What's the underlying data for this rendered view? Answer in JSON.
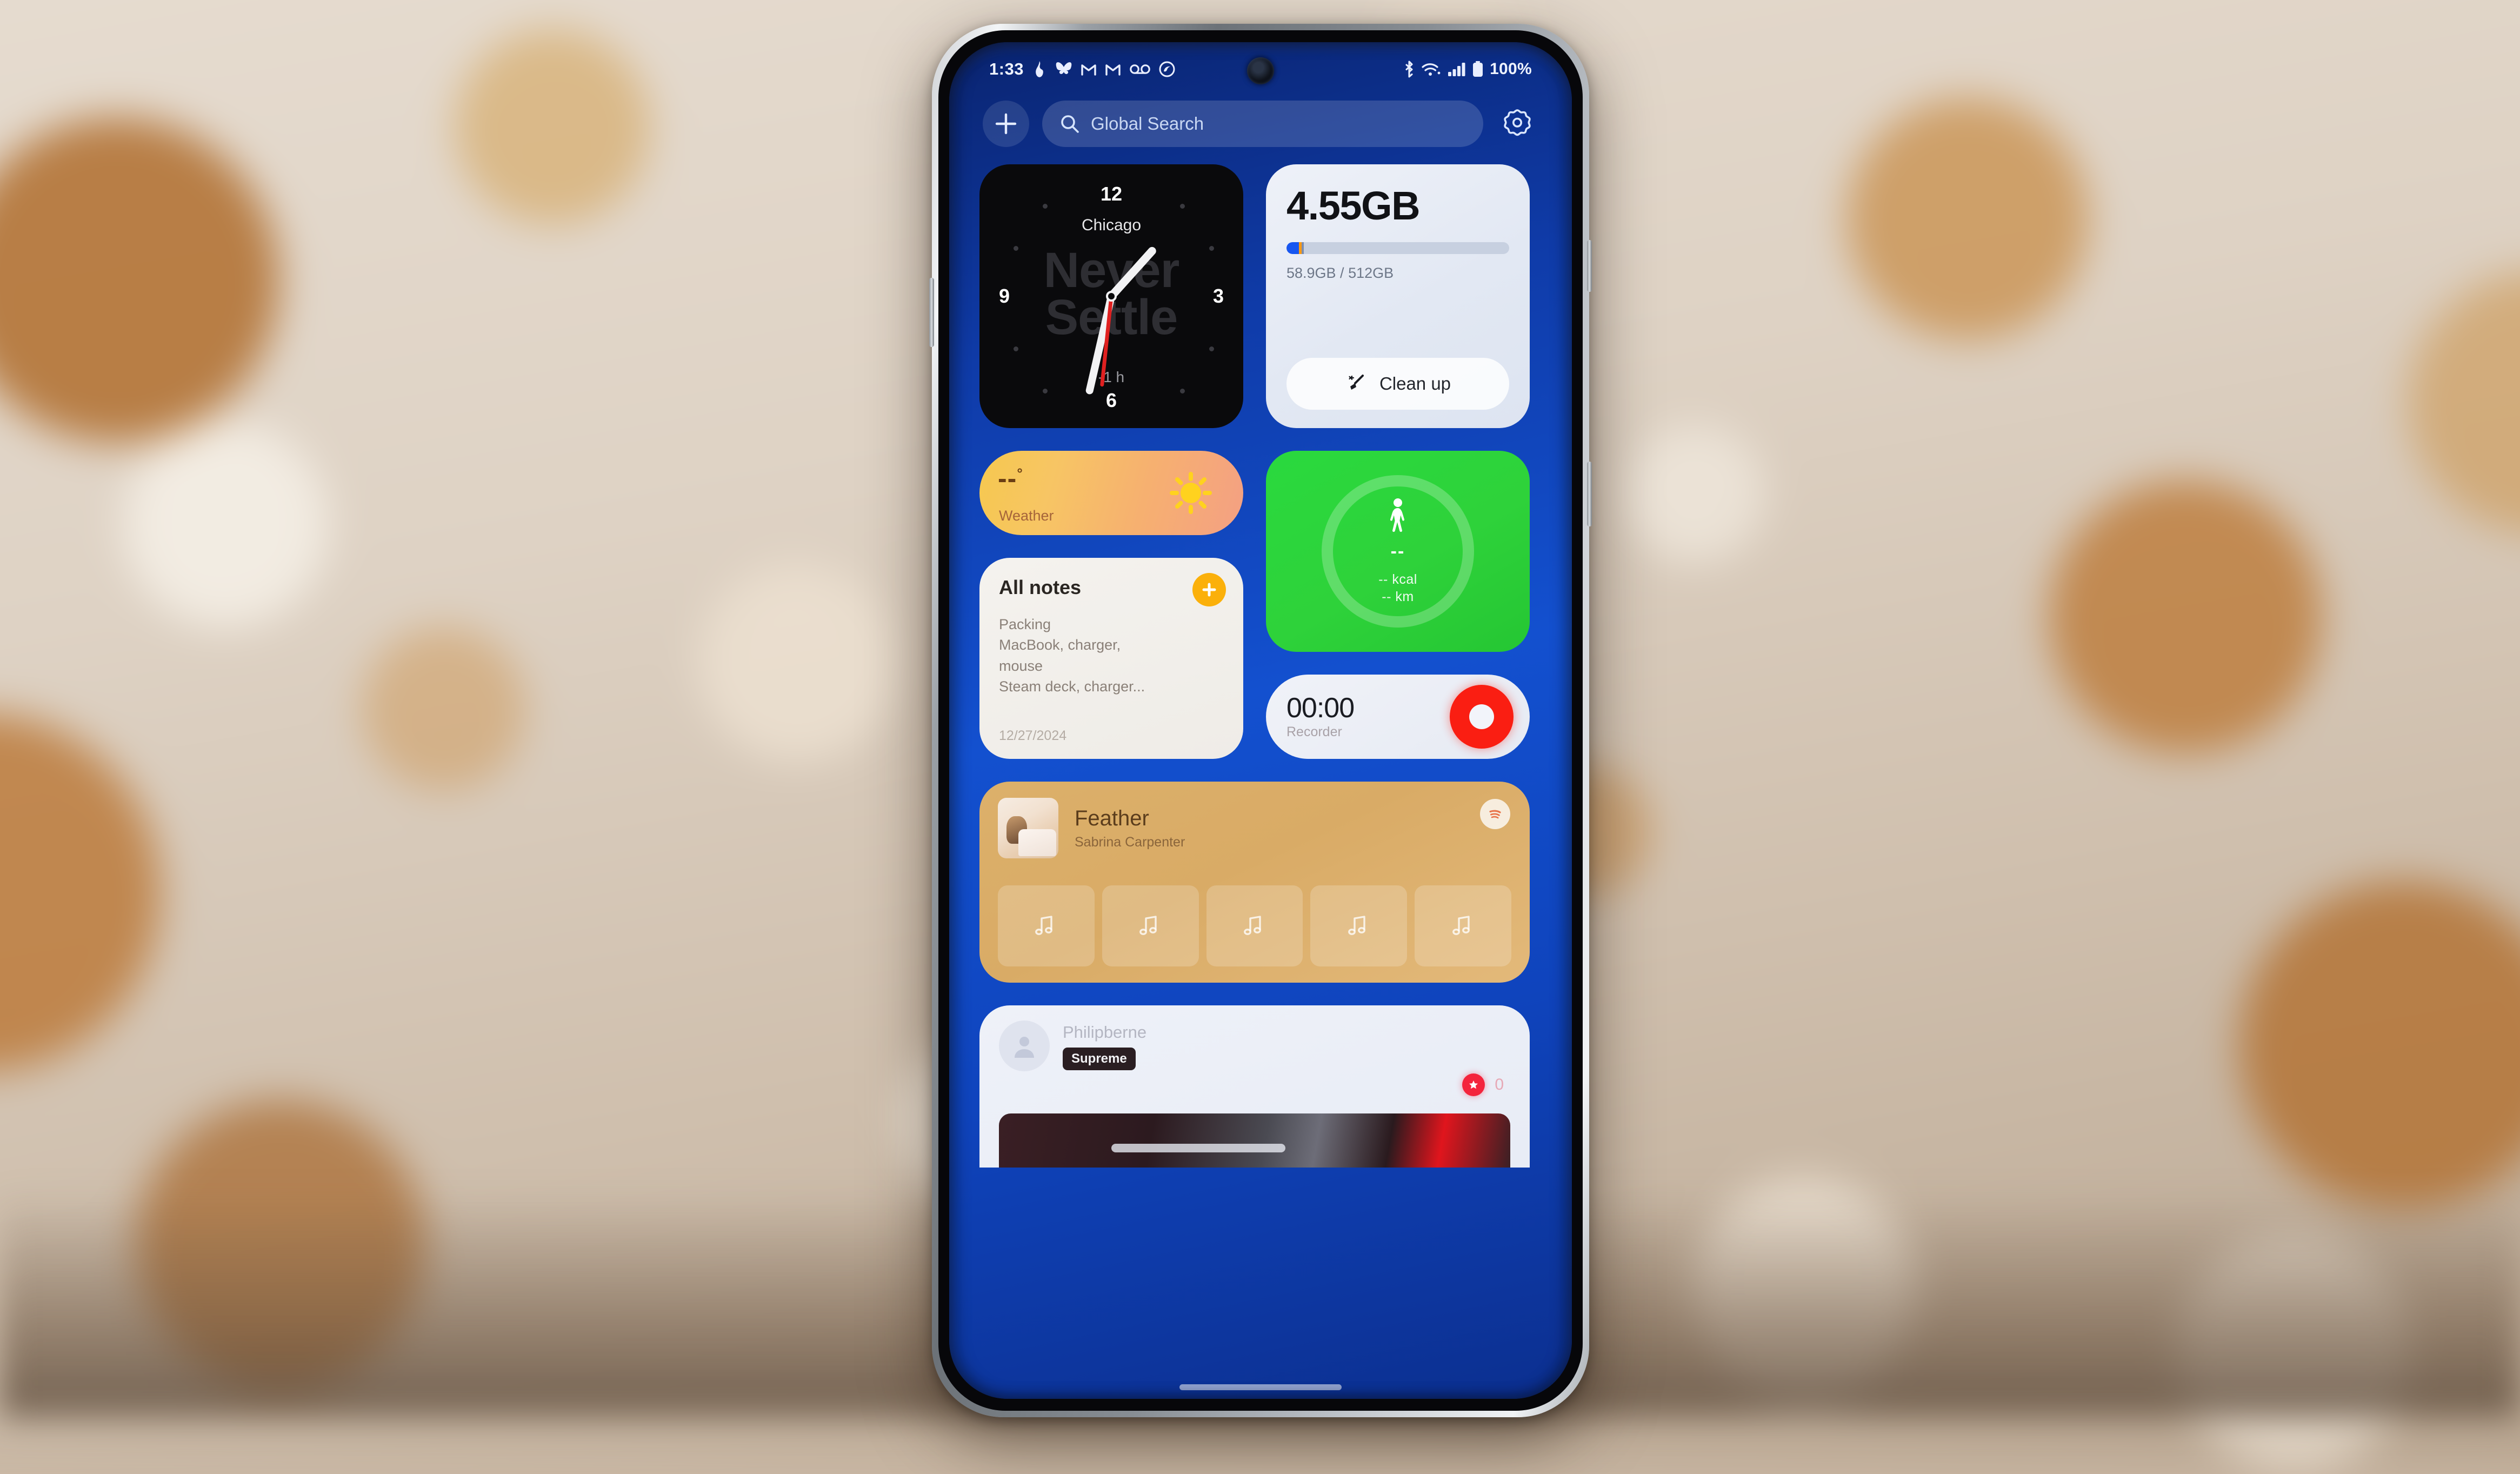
{
  "statusbar": {
    "time": "1:33",
    "battery_percent": "100%",
    "left_icons": [
      "flame-icon",
      "butterfly-icon",
      "gmail-icon",
      "gmail-icon-2",
      "voicemail-icon",
      "sync-icon"
    ],
    "right_icons": [
      "bluetooth-icon",
      "wifi-icon",
      "cellular-signal-icon",
      "battery-icon"
    ]
  },
  "header": {
    "add_label": "+",
    "search_placeholder": "Global Search",
    "search_value": "",
    "search_icon": "search-icon",
    "settings_icon": "gear-icon"
  },
  "widgets": {
    "clock": {
      "city": "Chicago",
      "brand": "Never\nSettle",
      "timezone_offset": "-1 h",
      "numerals": {
        "twelve": "12",
        "three": "3",
        "six": "6",
        "nine": "9"
      }
    },
    "storage": {
      "free": "4.55GB",
      "used_total": "58.9GB / 512GB",
      "clean_label": "Clean up",
      "clean_icon": "broom-icon",
      "used_percent": 11.5,
      "accent": "#1756f0"
    },
    "weather": {
      "temperature": "--",
      "degree": "°",
      "label": "Weather",
      "icon": "sun-icon"
    },
    "fitness": {
      "steps": "--",
      "calories": "-- kcal",
      "distance": "-- km",
      "icon": "walking-person-icon",
      "accent": "#2ad93e"
    },
    "notes": {
      "title": "All notes",
      "add_icon": "plus-icon",
      "body": "Packing\nMacBook, charger,\nmouse\nSteam deck, charger...",
      "date": "12/27/2024",
      "accent": "#fbb00a"
    },
    "recorder": {
      "time": "00:00",
      "label": "Recorder",
      "record_icon": "record-button-icon",
      "accent": "#fa1e12"
    },
    "music": {
      "title": "Feather",
      "artist": "Sabrina Carpenter",
      "app_icon": "spotify-icon",
      "album_art": "album-art-thumbnail",
      "tiles": [
        "music-note-icon",
        "music-note-icon",
        "music-note-icon",
        "music-note-icon",
        "music-note-icon"
      ]
    },
    "social": {
      "username": "Philipberne",
      "badge": "Supreme",
      "avatar_icon": "person-avatar-icon",
      "reaction_icon": "heart-badge-icon",
      "reaction_count": "0"
    }
  }
}
